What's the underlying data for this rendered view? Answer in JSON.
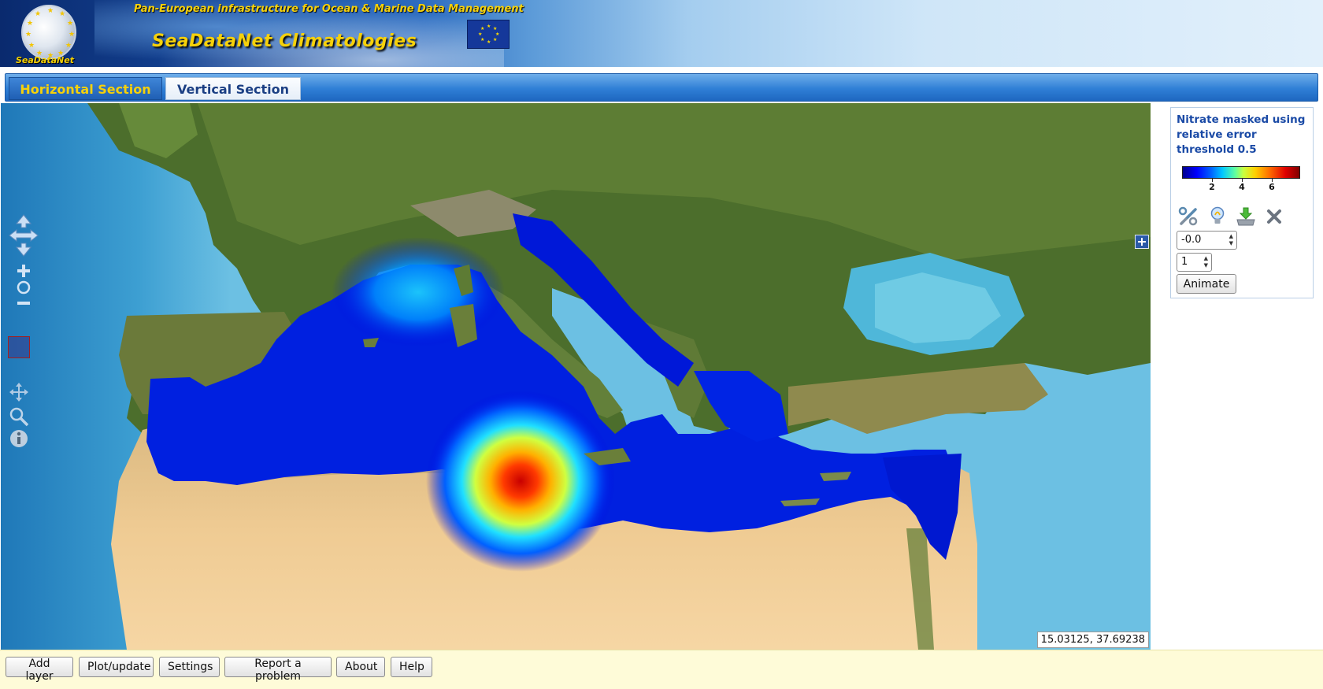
{
  "banner": {
    "logo_text": "SeaDataNet",
    "tagline": "Pan-European infrastructure for Ocean & Marine Data Management",
    "title": "SeaDataNet Climatologies"
  },
  "tabs": [
    {
      "label": "Horizontal Section",
      "active": true
    },
    {
      "label": "Vertical Section",
      "active": false
    }
  ],
  "map": {
    "coordinates": "15.03125, 37.69238",
    "controls": [
      "pan-up-icon",
      "pan-left-right-icon",
      "pan-down-icon",
      "zoom-in-icon",
      "zoom-world-icon",
      "zoom-out-icon",
      "drag-pan-icon",
      "zoom-box-icon",
      "info-icon",
      "layer-switcher-icon"
    ]
  },
  "legend": {
    "title": "Nitrate masked using relative error threshold 0.5",
    "colorbar_ticks": [
      "2",
      "4",
      "6"
    ],
    "colormap": [
      "#00008f",
      "#0000ff",
      "#00c8ff",
      "#c8ff40",
      "#ffd000",
      "#ff7000",
      "#e00000",
      "#800000"
    ],
    "icons": [
      "tools-icon",
      "lightbulb-icon",
      "download-icon",
      "close-icon"
    ],
    "depth_value": "-0.0",
    "time_value": "1",
    "animate_label": "Animate"
  },
  "toolbar": {
    "add_layer": "Add layer",
    "plot_update": "Plot/update",
    "settings": "Settings",
    "report_problem": "Report a problem",
    "about": "About",
    "help": "Help"
  },
  "colors": {
    "tab_bar": "#2f7fd6",
    "active_tab_text": "#f6d10a",
    "legend_title": "#1a4aa6",
    "bottom_bar": "#fefbd8"
  }
}
